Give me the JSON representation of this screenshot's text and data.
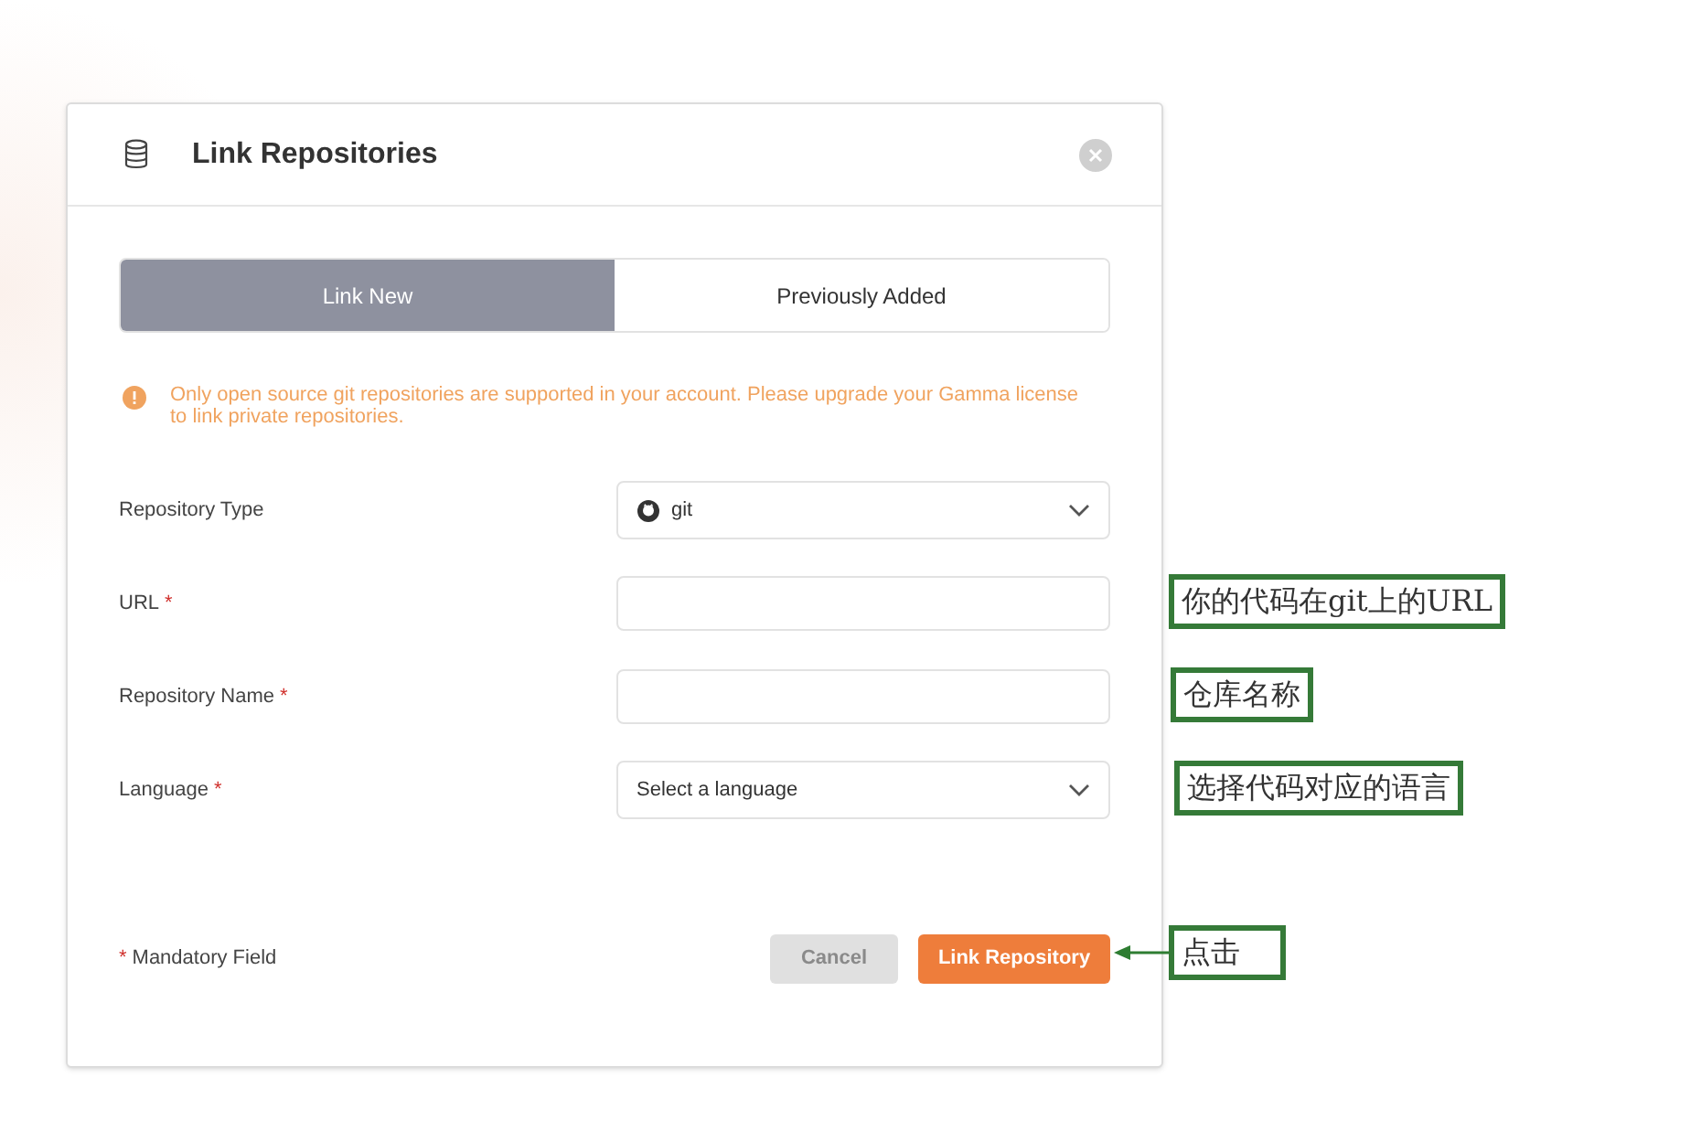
{
  "dialog": {
    "title": "Link Repositories",
    "tabs": [
      {
        "label": "Link New",
        "selected": true
      },
      {
        "label": "Previously Added",
        "selected": false
      }
    ],
    "notice": "Only open source git repositories are supported in your account. Please upgrade your Gamma license to link private repositories.",
    "fields": [
      {
        "label": "Repository Type",
        "kind": "select",
        "value": "git"
      },
      {
        "label": "URL",
        "required_mark": "*",
        "kind": "text"
      },
      {
        "label": "Repository Name",
        "required_mark": "*",
        "kind": "text"
      },
      {
        "label": "Language",
        "required_mark": "*",
        "kind": "select",
        "placeholder": "Select a language"
      }
    ],
    "mandatory_mark": "*",
    "mandatory_note": "Mandatory Field",
    "buttons": [
      {
        "label": "Cancel",
        "disabled": true
      },
      {
        "label": "Link Repository",
        "disabled": false
      }
    ]
  },
  "annotations": [
    {
      "text": "你的代码在git上的URL",
      "arrow": false
    },
    {
      "text": "仓库名称",
      "arrow": false
    },
    {
      "text": "选择代码对应的语言",
      "arrow": false
    },
    {
      "text": "点击",
      "arrow": true
    }
  ]
}
